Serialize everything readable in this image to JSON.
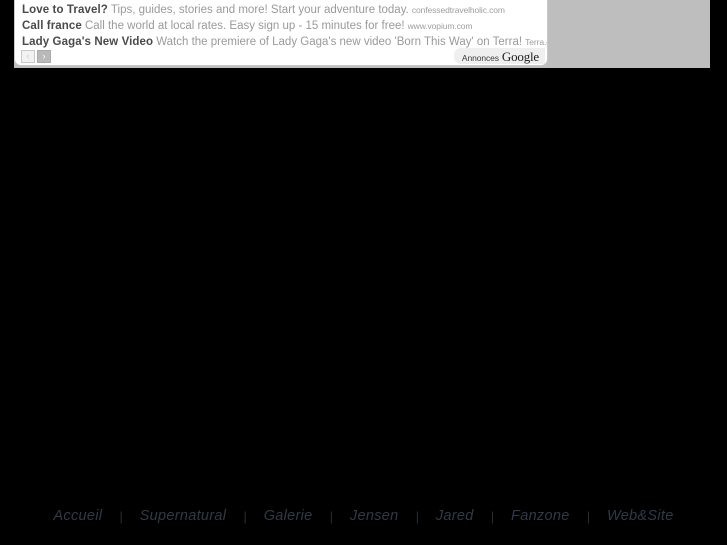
{
  "page": {
    "background_color": "#000000",
    "band_color": "#bebebe"
  },
  "ad_unit": {
    "provider_label_prefix": "Annonces",
    "provider_label_brand": "Google",
    "prev_arrow": "‹",
    "next_arrow": "›",
    "ads": [
      {
        "title": "Love to Travel?",
        "description": "Tips, guides, stories and more! Start your adventure today.",
        "url": "confessedtravelholic.com"
      },
      {
        "title": "Call france",
        "description": "Call the world at local rates. Easy sign up - 15 minutes for free!",
        "url": "www.vopium.com"
      },
      {
        "title": "Lady Gaga's New Video",
        "description": "Watch the premiere of Lady Gaga's new video 'Born This Way' on Terra!",
        "url": "Terra.com/Lady_Ga..."
      }
    ]
  },
  "bottom_nav": {
    "separator": "|",
    "items": [
      {
        "label": "Accueil"
      },
      {
        "label": "Supernatural"
      },
      {
        "label": "Galerie"
      },
      {
        "label": "Jensen"
      },
      {
        "label": "Jared"
      },
      {
        "label": "Fanzone"
      },
      {
        "label": "Web&Site"
      }
    ]
  }
}
